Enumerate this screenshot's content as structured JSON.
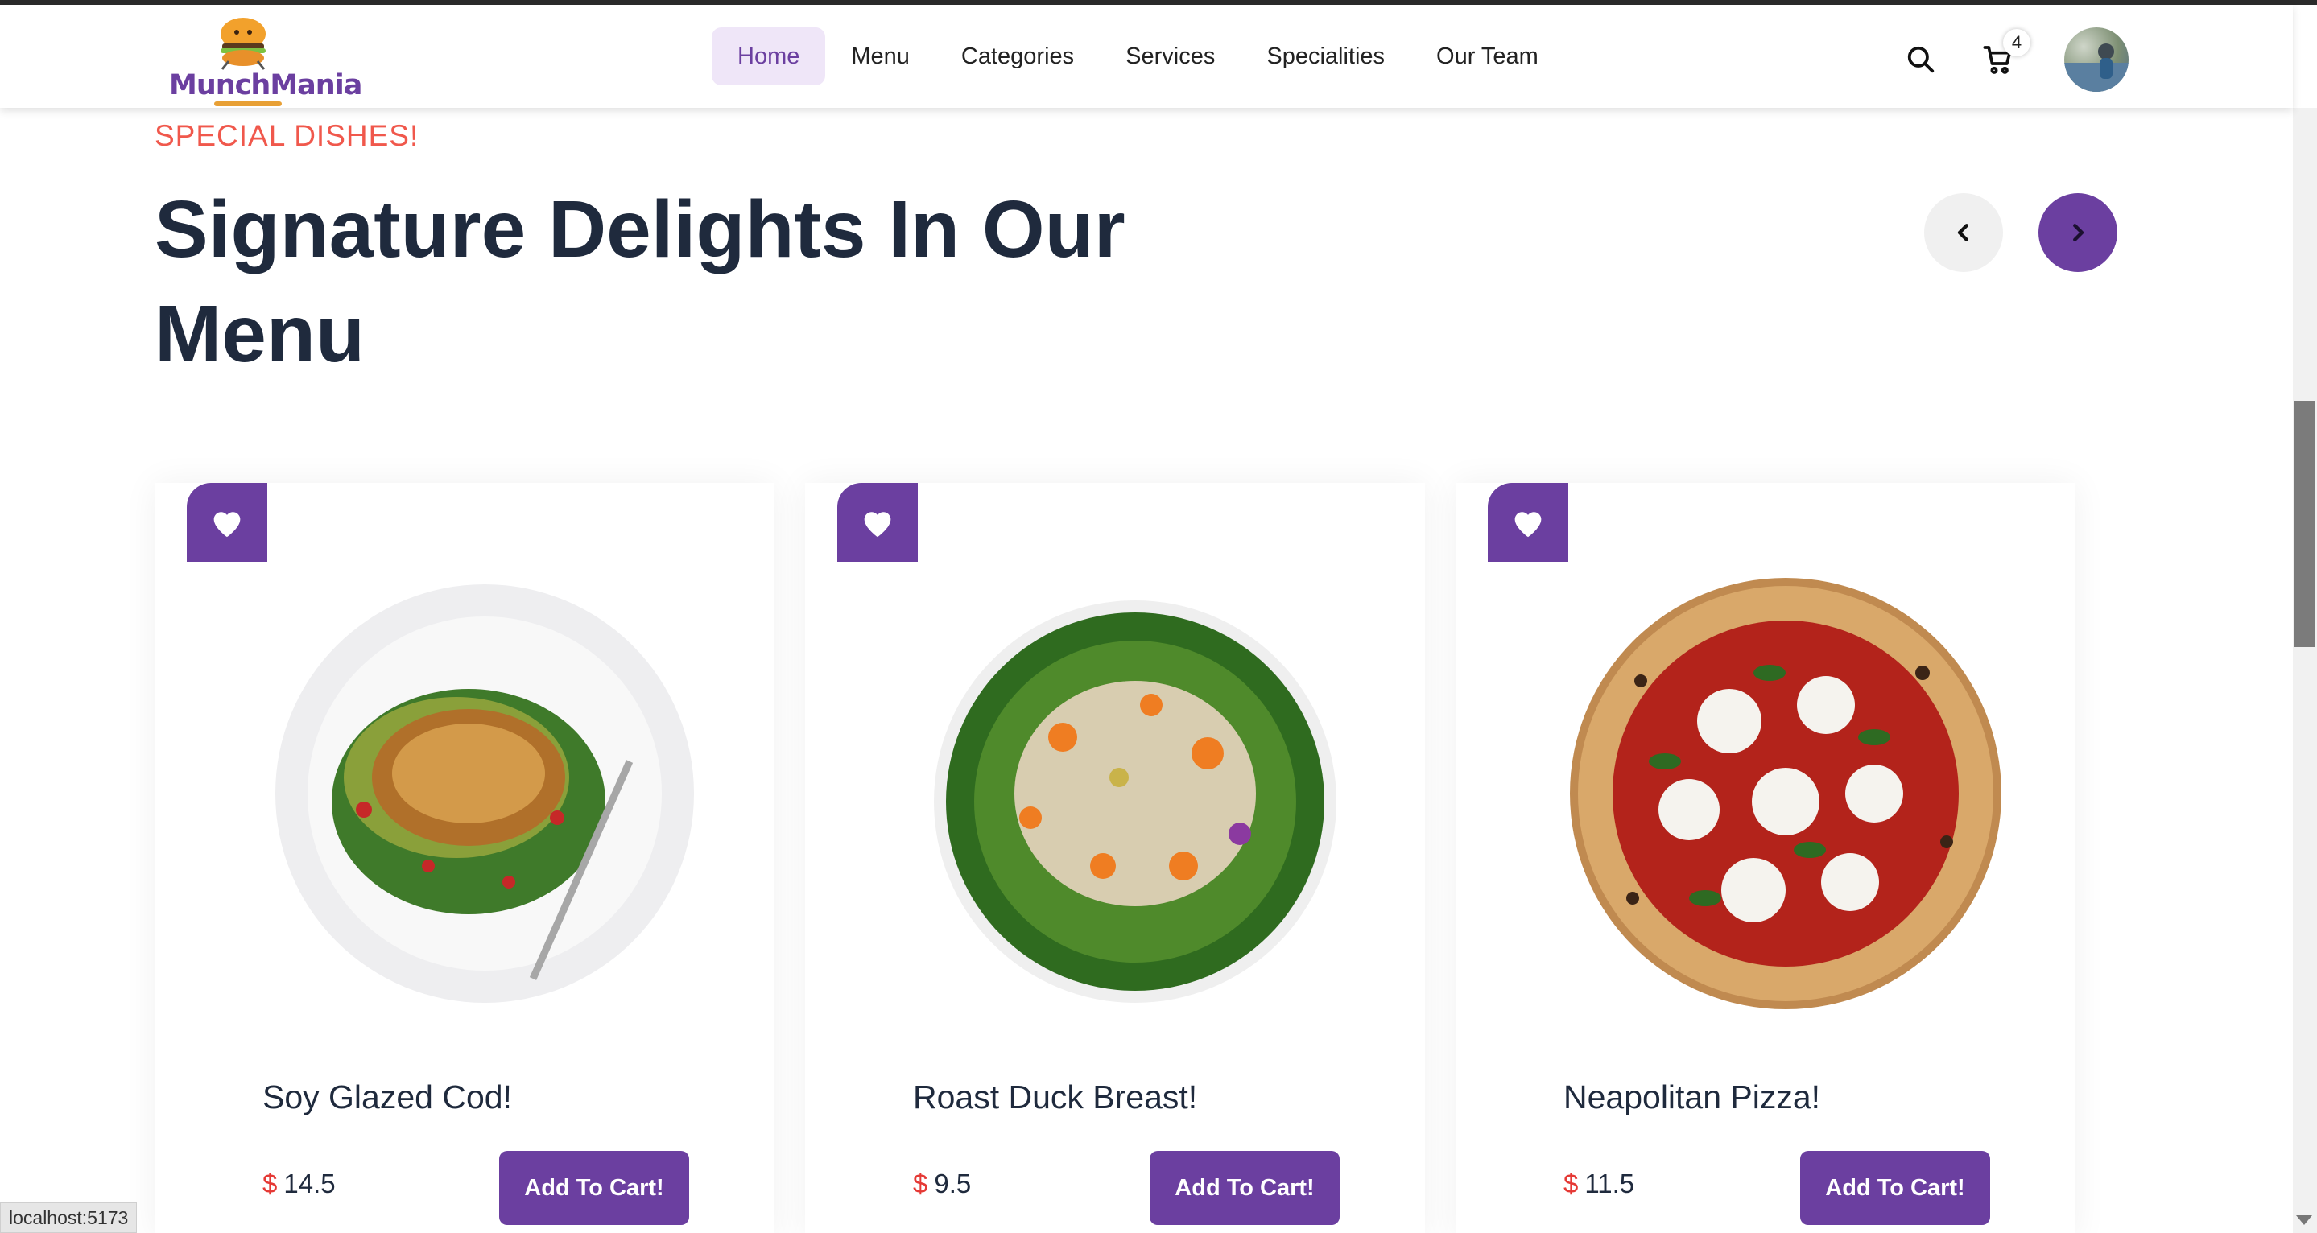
{
  "navbar": {
    "brand": "MunchMania",
    "items": [
      {
        "label": "Home",
        "active": true
      },
      {
        "label": "Menu"
      },
      {
        "label": "Categories"
      },
      {
        "label": "Services"
      },
      {
        "label": "Specialities"
      },
      {
        "label": "Our Team"
      }
    ],
    "cart_count": "4",
    "icons": [
      "search-icon",
      "cart-icon"
    ]
  },
  "section": {
    "eyebrow": "SPECIAL DISHES!",
    "title": "Signature Delights In Our Menu"
  },
  "dishes": [
    {
      "name": "Soy Glazed Cod!",
      "currency": "$",
      "price": "14.5",
      "button": "Add To Cart!"
    },
    {
      "name": "Roast Duck Breast!",
      "currency": "$",
      "price": "9.5",
      "button": "Add To Cart!"
    },
    {
      "name": "Neapolitan Pizza!",
      "currency": "$",
      "price": "11.5",
      "button": "Add To Cart!"
    }
  ],
  "status_url": "localhost:5173",
  "colors": {
    "accent": "#6b3fa0",
    "eyebrow": "#f0584c",
    "price_currency": "#e53935",
    "heading": "#1f2a3d"
  }
}
